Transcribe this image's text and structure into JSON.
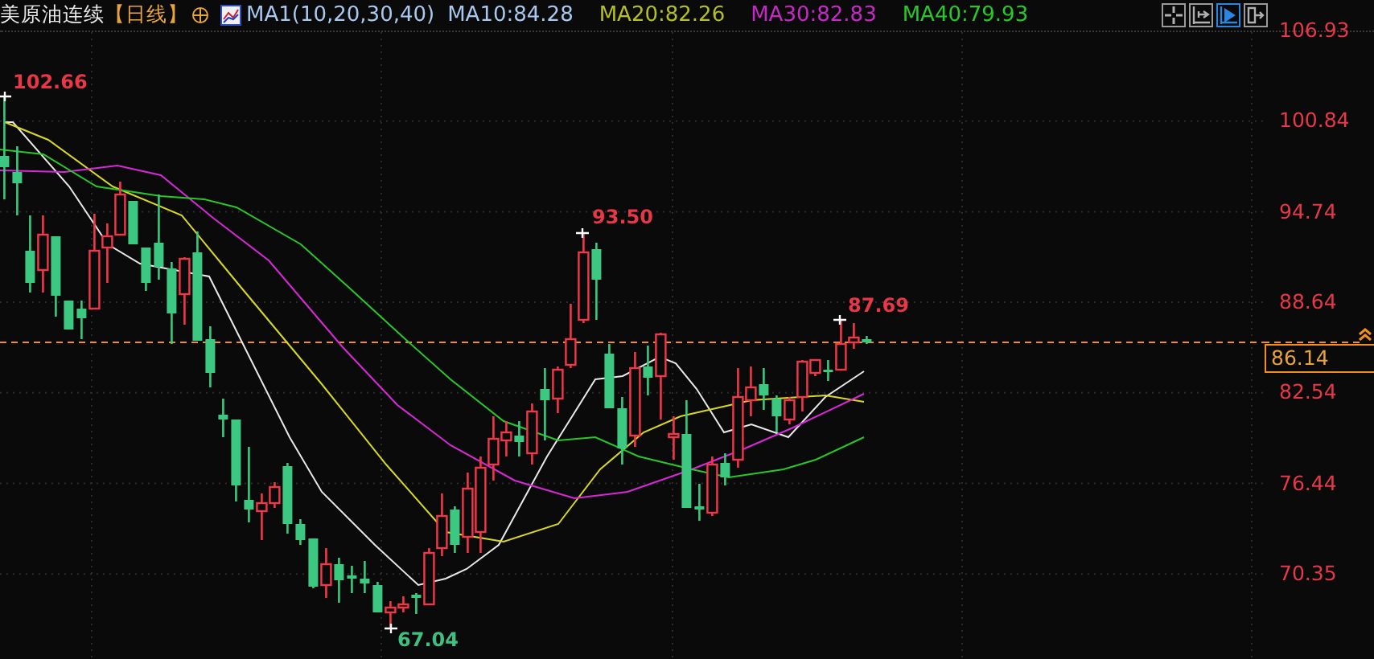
{
  "header": {
    "title": "美原油连续",
    "period": "【日线】",
    "indicator_name": "MA1(10,20,30,40)",
    "indicators": [
      {
        "label": "MA10:84.28",
        "color": "#a8c8f0"
      },
      {
        "label": "MA20:82.26",
        "color": "#b4c020"
      },
      {
        "label": "MA30:82.83",
        "color": "#c828c8"
      },
      {
        "label": "MA40:79.93",
        "color": "#28c828"
      }
    ]
  },
  "toolbar_buttons": [
    {
      "kind": "crosshair",
      "selected": false
    },
    {
      "kind": "range",
      "selected": false
    },
    {
      "kind": "play",
      "selected": true
    },
    {
      "kind": "exit",
      "selected": false
    }
  ],
  "price_axis": {
    "ticks": [
      "106.93",
      "100.84",
      "94.74",
      "88.64",
      "82.54",
      "76.44",
      "70.35"
    ],
    "current_price": "86.14"
  },
  "annotations": [
    {
      "label": "102.66",
      "color": "#e83848"
    },
    {
      "label": "93.50",
      "color": "#e83848"
    },
    {
      "label": "87.69",
      "color": "#e83848"
    },
    {
      "label": "67.04",
      "color": "#40c080"
    }
  ]
}
